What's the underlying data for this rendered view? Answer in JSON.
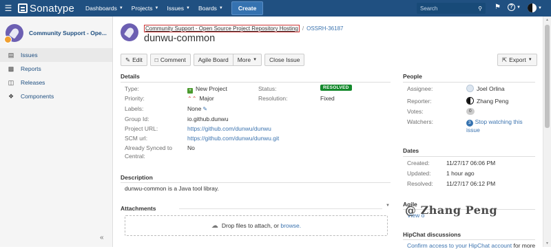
{
  "topbar": {
    "logo": "Sonatype",
    "nav": [
      {
        "label": "Dashboards"
      },
      {
        "label": "Projects"
      },
      {
        "label": "Issues"
      },
      {
        "label": "Boards"
      }
    ],
    "create_label": "Create",
    "search_placeholder": "Search",
    "brand_color": "#205081"
  },
  "sidebar": {
    "project_name": "Community Support - Ope...",
    "items": [
      {
        "label": "Issues",
        "icon": "issues-icon",
        "active": true
      },
      {
        "label": "Reports",
        "icon": "reports-icon"
      },
      {
        "label": "Releases",
        "icon": "releases-icon"
      },
      {
        "label": "Components",
        "icon": "components-icon"
      }
    ],
    "collapse_glyph": "«"
  },
  "issue": {
    "project_link": "Community Support - Open Source Project Repository Hosting",
    "key": "OSSRH-36187",
    "title": "dunwu-common"
  },
  "toolbar": {
    "edit": "Edit",
    "comment": "Comment",
    "agile_board": "Agile Board",
    "more": "More",
    "close_issue": "Close Issue",
    "export": "Export"
  },
  "details": {
    "heading": "Details",
    "type_label": "Type:",
    "type_value": "New Project",
    "priority_label": "Priority:",
    "priority_value": "Major",
    "labels_label": "Labels:",
    "labels_value": "None",
    "group_id_label": "Group Id:",
    "group_id_value": "io.github.dunwu",
    "project_url_label": "Project URL:",
    "project_url_value": "https://github.com/dunwu/dunwu",
    "scm_url_label": "SCM url:",
    "scm_url_value": "https://github.com/dunwu/dunwu.git",
    "synced_label_1": "Already Synced to",
    "synced_label_2": "Central:",
    "synced_value": "No",
    "status_label": "Status:",
    "status_value": "RESOLVED",
    "resolution_label": "Resolution:",
    "resolution_value": "Fixed"
  },
  "description": {
    "heading": "Description",
    "text": "dunwu-common is a Java tool libray."
  },
  "attachments": {
    "heading": "Attachments",
    "drop_text": "Drop files to attach, or",
    "browse": "browse."
  },
  "people": {
    "heading": "People",
    "assignee_label": "Assignee:",
    "assignee_value": "Joel Orlina",
    "reporter_label": "Reporter:",
    "reporter_value": "Zhang Peng",
    "votes_label": "Votes:",
    "votes_value": "0",
    "watchers_label": "Watchers:",
    "watchers_count": "3",
    "watchers_link_1": "Stop watching this",
    "watchers_link_2": "issue"
  },
  "dates": {
    "heading": "Dates",
    "created_label": "Created:",
    "created_value": "11/27/17 06:06 PM",
    "updated_label": "Updated:",
    "updated_value": "1 hour ago",
    "resolved_label": "Resolved:",
    "resolved_value": "11/27/17 06:12 PM"
  },
  "agile": {
    "heading": "Agile",
    "link_fragment": "View o"
  },
  "hipchat": {
    "heading": "HipChat discussions",
    "link": "Confirm access to your HipChat account",
    "suffix": "for more"
  },
  "watermark": "@ Zhang Peng"
}
